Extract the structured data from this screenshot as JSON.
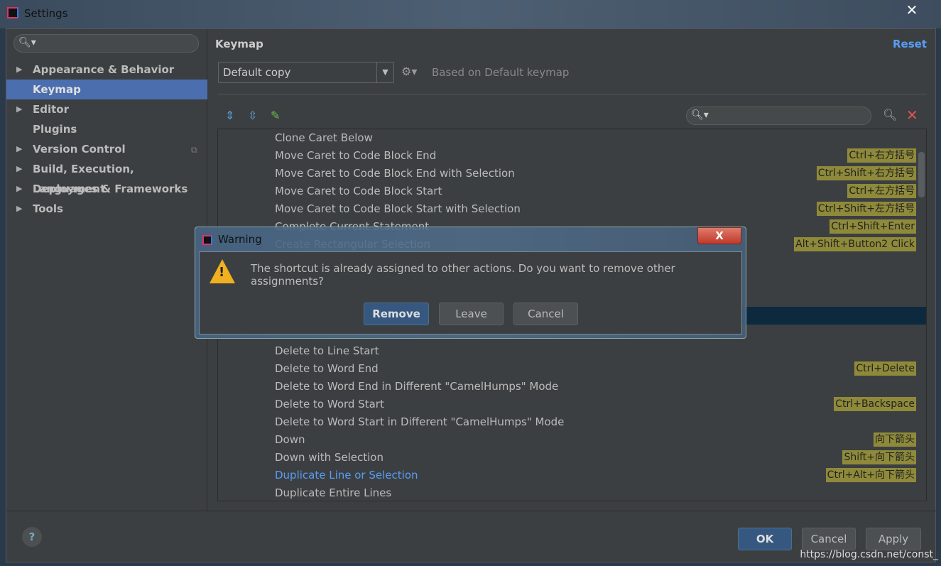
{
  "window": {
    "title": "Settings",
    "close": "✕"
  },
  "sidebar": {
    "items": [
      {
        "label": "Appearance & Behavior",
        "expandable": true
      },
      {
        "label": "Keymap",
        "expandable": false,
        "selected": true
      },
      {
        "label": "Editor",
        "expandable": true
      },
      {
        "label": "Plugins",
        "expandable": false
      },
      {
        "label": "Version Control",
        "expandable": true
      },
      {
        "label": "Build, Execution, Deployment",
        "expandable": true
      },
      {
        "label": "Languages & Frameworks",
        "expandable": true
      },
      {
        "label": "Tools",
        "expandable": true
      }
    ]
  },
  "keymap": {
    "title": "Keymap",
    "reset": "Reset",
    "selected_keymap": "Default copy",
    "based_on": "Based on Default keymap",
    "rows": [
      {
        "name": "Clone Caret Below",
        "shortcut": ""
      },
      {
        "name": "Move Caret to Code Block End",
        "shortcut": "Ctrl+右方括号"
      },
      {
        "name": "Move Caret to Code Block End with Selection",
        "shortcut": "Ctrl+Shift+右方括号"
      },
      {
        "name": "Move Caret to Code Block Start",
        "shortcut": "Ctrl+左方括号"
      },
      {
        "name": "Move Caret to Code Block Start with Selection",
        "shortcut": "Ctrl+Shift+左方括号"
      },
      {
        "name": "Complete Current Statement",
        "shortcut": "Ctrl+Shift+Enter"
      },
      {
        "name": "Create Rectangular Selection",
        "shortcut": "Alt+Shift+Button2 Click"
      },
      {
        "name": "",
        "shortcut": ""
      },
      {
        "name": "",
        "shortcut": ""
      },
      {
        "name": "",
        "shortcut": ""
      },
      {
        "name": "",
        "shortcut": "",
        "selected": true
      },
      {
        "name": "",
        "shortcut": ""
      },
      {
        "name": "Delete to Line Start",
        "shortcut": ""
      },
      {
        "name": "Delete to Word End",
        "shortcut": "Ctrl+Delete"
      },
      {
        "name": "Delete to Word End in Different \"CamelHumps\" Mode",
        "shortcut": ""
      },
      {
        "name": "Delete to Word Start",
        "shortcut": "Ctrl+Backspace"
      },
      {
        "name": "Delete to Word Start in Different \"CamelHumps\" Mode",
        "shortcut": ""
      },
      {
        "name": "Down",
        "shortcut": "向下箭头"
      },
      {
        "name": "Down with Selection",
        "shortcut": "Shift+向下箭头"
      },
      {
        "name": "Duplicate Line or Selection",
        "shortcut": "Ctrl+Alt+向下箭头",
        "highlight": true
      },
      {
        "name": "Duplicate Entire Lines",
        "shortcut": ""
      }
    ]
  },
  "footer": {
    "help": "?",
    "ok": "OK",
    "cancel": "Cancel",
    "apply": "Apply",
    "watermark": "https://blog.csdn.net/const_"
  },
  "dialog": {
    "title": "Warning",
    "message": "The shortcut is already assigned to other actions. Do you want to remove other assignments?",
    "remove": "Remove",
    "leave": "Leave",
    "cancel": "Cancel",
    "close": "X"
  }
}
